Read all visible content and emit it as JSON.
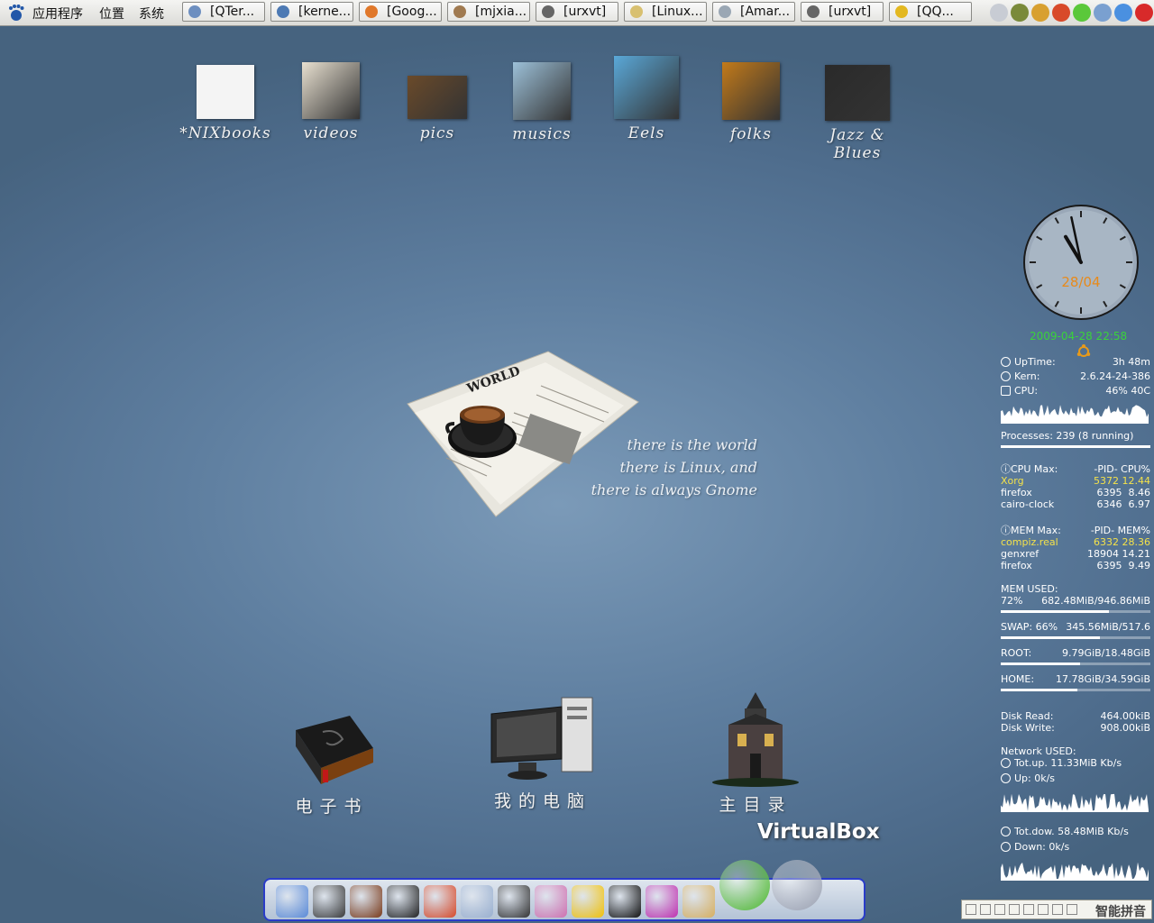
{
  "top_panel": {
    "menus": [
      "应用程序",
      "位置",
      "系统"
    ],
    "tasks": [
      {
        "label": "[QTer...",
        "icon": "qterm-icon",
        "color": "#6d8fc0"
      },
      {
        "label": "[kerne...",
        "icon": "chromium-icon",
        "color": "#4d7ab4"
      },
      {
        "label": "[Goog...",
        "icon": "firefox-icon",
        "color": "#e0782a"
      },
      {
        "label": "[mjxia...",
        "icon": "upload-icon",
        "color": "#a07a50"
      },
      {
        "label": "[urxvt]",
        "icon": "terminal-window-icon",
        "color": "#666666"
      },
      {
        "label": "[Linux...",
        "icon": "document-icon",
        "color": "#d8c070"
      },
      {
        "label": "[Amar...",
        "icon": "amarok-icon",
        "color": "#9aa7b4"
      },
      {
        "label": "[urxvt]",
        "icon": "terminal-window-icon",
        "color": "#666666"
      },
      {
        "label": "[QQ...",
        "icon": "qq-icon",
        "color": "#e3b820"
      }
    ],
    "tray_icons": [
      "network-icon",
      "archive-icon",
      "bird-icon",
      "qq-tray-icon",
      "green-status-icon",
      "volume-icon",
      "chat-icon",
      "close-red-icon"
    ]
  },
  "desktop_icons": [
    {
      "label": "*NIXbooks",
      "icon": "gnu-head-icon",
      "color": "#f2f2f2"
    },
    {
      "label": "videos",
      "icon": "forrest-gump-cover-icon",
      "color": "#e8e0d0"
    },
    {
      "label": "pics",
      "icon": "desk-photo-icon",
      "color": "#6a4a2a"
    },
    {
      "label": "musics",
      "icon": "forever-young-cover-icon",
      "color": "#9cc0d8"
    },
    {
      "label": "Eels",
      "icon": "eels-cover-icon",
      "color": "#5aa8d8"
    },
    {
      "label": "folks",
      "icon": "folk-album-cover-icon",
      "color": "#c27a1a"
    },
    {
      "label": "Jazz & Blues",
      "icon": "miles-davis-cover-icon",
      "color": "#2a2a2a"
    }
  ],
  "big_icons": [
    {
      "label": "电子书",
      "icon": "ebook-icon"
    },
    {
      "label": "我的电脑",
      "icon": "computer-icon"
    },
    {
      "label": "主目录",
      "icon": "home-folder-icon"
    }
  ],
  "wallpaper": {
    "newspaper_headline": "WORLD",
    "quote_lines": [
      "there is the world",
      "there is Linux, and",
      "there is always Gnome"
    ]
  },
  "clock": {
    "date": "28/04",
    "hour": 22,
    "minute": 58
  },
  "conky": {
    "datetime": "2009-04-28 22:58",
    "uptime_label": "UpTime:",
    "uptime": "3h 48m",
    "kern_label": "Kern:",
    "kern": "2.6.24-24-386",
    "cpu_label": "CPU:",
    "cpu": "46% 40C",
    "processes": "Processes:  239  (8 running)",
    "cpu_max": {
      "header": [
        "CPU Max:",
        "-PID-  CPU%"
      ],
      "rows": [
        {
          "name": "Xorg",
          "value": "5372 12.44",
          "highlight": true
        },
        {
          "name": "firefox",
          "value": "6395  8.46",
          "highlight": false
        },
        {
          "name": "cairo-clock",
          "value": "6346  6.97",
          "highlight": false
        }
      ]
    },
    "mem_max": {
      "header": [
        "MEM Max:",
        "-PID-  MEM%"
      ],
      "rows": [
        {
          "name": "compiz.real",
          "value": "6332 28.36",
          "highlight": true
        },
        {
          "name": "genxref",
          "value": "18904 14.21",
          "highlight": false
        },
        {
          "name": "firefox",
          "value": "6395  9.49",
          "highlight": false
        }
      ]
    },
    "mem_used_label": "MEM USED:",
    "mem_pct": "72%",
    "mem": "682.48MiB/946.86MiB",
    "mem_fraction": 0.72,
    "swap_label": "SWAP: 66%",
    "swap": "345.56MiB/517.6",
    "swap_fraction": 0.66,
    "root_label": "ROOT:",
    "root": "9.79GiB/18.48GiB",
    "root_fraction": 0.53,
    "home_label": "HOME:",
    "home": "17.78GiB/34.59GiB",
    "home_fraction": 0.51,
    "disk_read_label": "Disk Read:",
    "disk_read": "464.00kiB",
    "disk_write_label": "Disk Write:",
    "disk_write": "908.00kiB",
    "network_label": "Network USED:",
    "tot_up": "Tot.up. 11.33MiB Kb/s",
    "up": "Up: 0k/s",
    "tot_down": "Tot.dow. 58.48MiB Kb/s",
    "down": "Down: 0k/s"
  },
  "dock": {
    "items": [
      {
        "icon": "finder-mac-icon",
        "color": "#5a8ad8"
      },
      {
        "icon": "haunted-house-icon",
        "color": "#3a3a3a"
      },
      {
        "icon": "book-icon",
        "color": "#7a3a1a"
      },
      {
        "icon": "terminal-icon",
        "color": "#222222"
      },
      {
        "icon": "chrome-icon",
        "color": "#d84a2a"
      },
      {
        "icon": "pidgin-icon",
        "color": "#9ab0d0"
      },
      {
        "icon": "monitor-icon",
        "color": "#333333"
      },
      {
        "icon": "music-note-icon",
        "color": "#d070b0"
      },
      {
        "icon": "aim-icon",
        "color": "#f2c20a"
      },
      {
        "icon": "qq-penguin-icon",
        "color": "#111111"
      },
      {
        "icon": "qq-player-icon",
        "color": "#c030b0"
      },
      {
        "icon": "disc-package-icon",
        "color": "#d8b060"
      },
      {
        "icon": "green-apple-icon",
        "color": "#4ab82a"
      },
      {
        "icon": "virtualbox-icon",
        "color": "#9aa0b0"
      }
    ],
    "virtualbox_label": "VirtualBox"
  },
  "ime": {
    "text": "智能拼音",
    "icons": [
      "penguin-icon",
      "pinyin-icon",
      "moon-icon",
      "feather-icon",
      "full-width-icon",
      "traditional-icon",
      "complex-icon",
      "keyboard-icon"
    ]
  }
}
